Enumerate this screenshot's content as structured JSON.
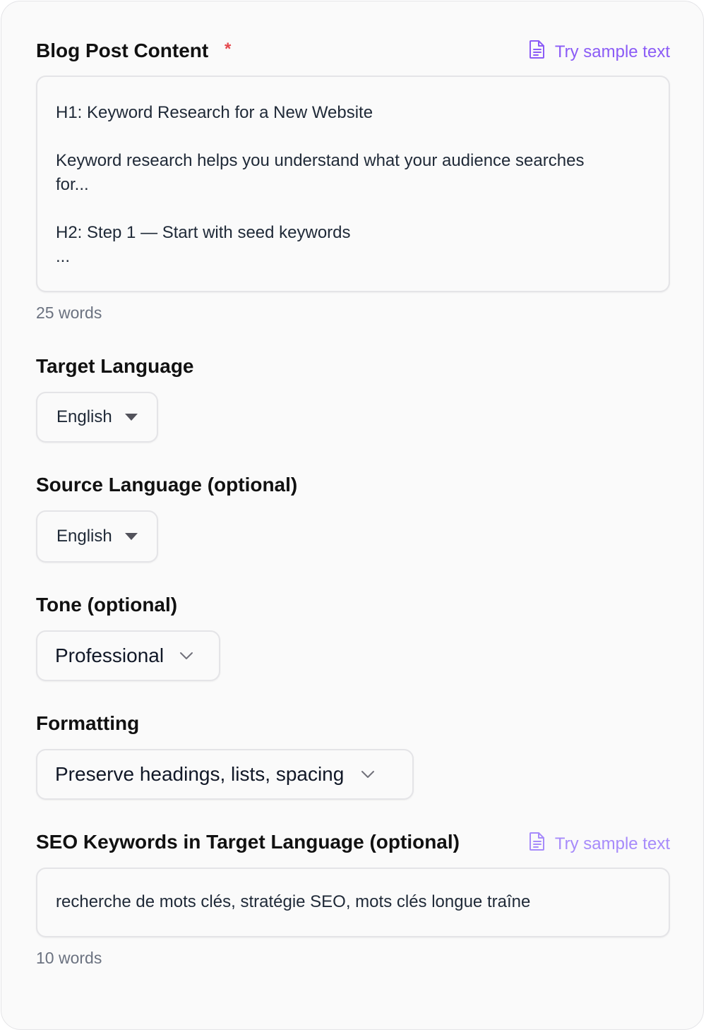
{
  "colors": {
    "accent": "#8b5cf6",
    "accent_light": "#a78bfa",
    "required": "#e5484d",
    "muted_text": "#6b7280",
    "border": "#e4e4e7"
  },
  "blog_post": {
    "label": "Blog Post Content",
    "required_mark": "*",
    "sample_link": "Try sample text",
    "sample_icon": "document-icon",
    "content_lines": [
      "H1: Keyword Research for a New Website",
      "",
      "Keyword research helps you understand what your audience searches",
      "for...",
      "",
      "H2: Step 1 — Start with seed keywords",
      "..."
    ],
    "word_count": "25 words"
  },
  "target_language": {
    "label": "Target Language",
    "value": "English",
    "icon": "caret-down-icon"
  },
  "source_language": {
    "label": "Source Language (optional)",
    "value": "English",
    "icon": "caret-down-icon"
  },
  "tone": {
    "label": "Tone (optional)",
    "value": "Professional",
    "icon": "chevron-down-icon"
  },
  "formatting": {
    "label": "Formatting",
    "value": "Preserve headings, lists, spacing",
    "icon": "chevron-down-icon"
  },
  "seo_keywords": {
    "label": "SEO Keywords in Target Language (optional)",
    "sample_link": "Try sample text",
    "sample_icon": "document-icon",
    "value": "recherche de mots clés, stratégie SEO, mots clés longue traîne",
    "word_count": "10 words"
  }
}
